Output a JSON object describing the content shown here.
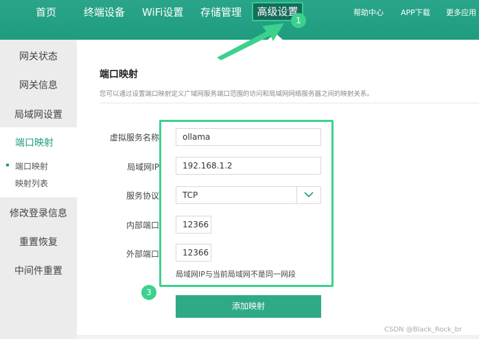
{
  "nav": {
    "items": [
      "首页",
      "终端设备",
      "WiFi设置",
      "存储管理"
    ],
    "active": "高级设置",
    "right_links": [
      "帮助中心",
      "APP下载",
      "更多应用"
    ]
  },
  "sidebar": {
    "items": [
      "网关状态",
      "网关信息",
      "局域网设置",
      "修改登录信息",
      "重置恢复",
      "中间件重置"
    ],
    "group_title": "端口映射",
    "sub_items": [
      "端口映射",
      "映射列表"
    ]
  },
  "page": {
    "title": "端口映射",
    "description": "您可以通过设置端口映射定义广域网服务端口范围的访问和局域网网络服务器之间的映射关系。"
  },
  "form": {
    "service_name_label": "虚拟服务名称",
    "service_name_value": "ollama",
    "lan_ip_label": "局域网IP",
    "lan_ip_value": "192.168.1.2",
    "protocol_label": "服务协议",
    "protocol_value": "TCP",
    "internal_port_label": "内部端口",
    "internal_port_value": "12366",
    "external_port_label": "外部端口",
    "external_port_value": "12366",
    "hint": "局域网IP与当前局域网不是同一网段",
    "submit_label": "添加映射"
  },
  "annotations": {
    "badge_1": "1",
    "badge_3": "3",
    "arrow_color": "#3ad28d"
  },
  "watermark": "CSDN @Black_Rock_br",
  "colors": {
    "brand": "#1f9c80",
    "highlight": "#3ad28d",
    "button": "#2eaa86"
  }
}
